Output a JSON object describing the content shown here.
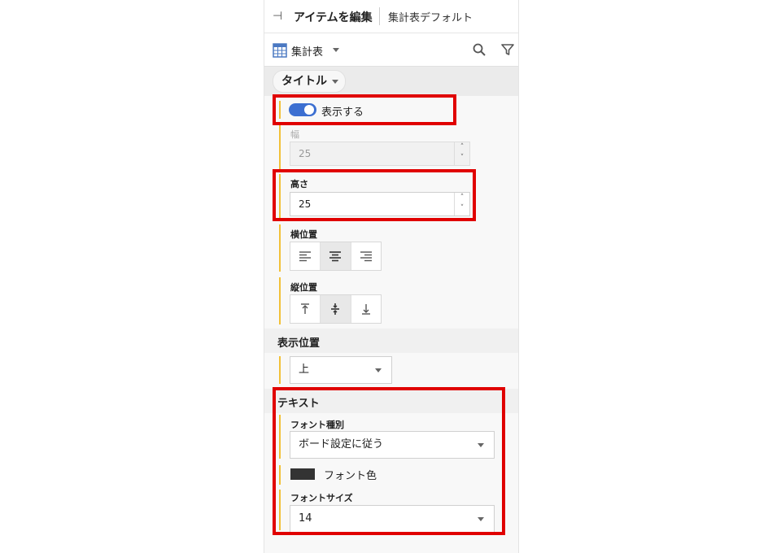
{
  "header": {
    "title": "アイテムを編集",
    "subtitle": "集計表デフォルト"
  },
  "toolbar": {
    "item_type": "集計表"
  },
  "section": {
    "chip_label": "タイトル"
  },
  "display": {
    "toggle_label": "表示する",
    "toggle_on": true
  },
  "width_field": {
    "label": "幅",
    "value": "25",
    "disabled": true
  },
  "height_field": {
    "label": "高さ",
    "value": "25"
  },
  "h_align": {
    "label": "横位置",
    "options": [
      "left",
      "center",
      "right"
    ],
    "selected": "center"
  },
  "v_align": {
    "label": "縦位置",
    "options": [
      "top",
      "middle",
      "bottom"
    ],
    "selected": "middle"
  },
  "position": {
    "heading": "表示位置",
    "value": "上"
  },
  "text": {
    "heading": "テキスト",
    "font_type_label": "フォント種別",
    "font_type_value": "ボード設定に従う",
    "font_color_label": "フォント色",
    "font_color": "#333333",
    "font_size_label": "フォントサイズ",
    "font_size_value": "14"
  },
  "colors": {
    "accent": "#f2c037",
    "toggle": "#3c6fd1",
    "highlight": "#e00000"
  },
  "icons": [
    "pin-icon",
    "table-icon",
    "search-icon",
    "filter-icon",
    "align-left-icon",
    "align-center-icon",
    "align-right-icon",
    "align-top-icon",
    "align-middle-icon",
    "align-bottom-icon"
  ]
}
